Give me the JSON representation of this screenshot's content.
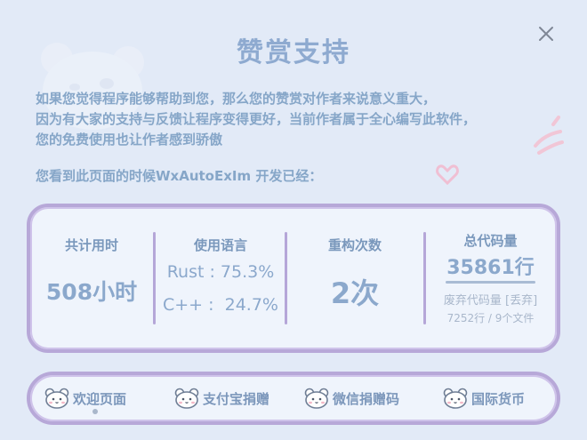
{
  "dialog": {
    "title": "赞赏支持",
    "description_lines": [
      "如果您觉得程序能够帮助到您，那么您的赞赏对作者来说意义重大，",
      "因为有大家的支持与反馈让程序变得更好，当前作者属于全心编写此软件，",
      "您的免费使用也让作者感到骄傲"
    ],
    "since_text": "您看到此页面的时候WxAutoExIm 开发已经："
  },
  "stats": {
    "total_time": {
      "label": "共计用时",
      "value": "508小时"
    },
    "languages": {
      "label": "使用语言",
      "items": [
        {
          "name": "Rust",
          "text": "Rust : 75.3%"
        },
        {
          "name": "C++",
          "text": "C++ :  24.7%"
        }
      ]
    },
    "refactor": {
      "label": "重构次数",
      "value": "2次"
    },
    "code": {
      "label": "总代码量",
      "value": "35861行",
      "discarded_label": "废弃代码量 [丢弃]",
      "discarded_value": "7252行 / 9个文件"
    }
  },
  "nav": {
    "items": [
      {
        "label": "欢迎页面",
        "icon": "bear-icon",
        "active": true
      },
      {
        "label": "支付宝捐赠",
        "icon": "bear-icon"
      },
      {
        "label": "微信捐赠码",
        "icon": "bear-icon"
      },
      {
        "label": "国际货币",
        "icon": "bear-icon"
      }
    ]
  },
  "icons": {
    "close": "close-icon",
    "background": "bear-face-icon"
  },
  "colors": {
    "background": "#e2eaf7",
    "text": "#86a6c8",
    "border": "#b7a8d8",
    "card": "#eff4fc"
  }
}
